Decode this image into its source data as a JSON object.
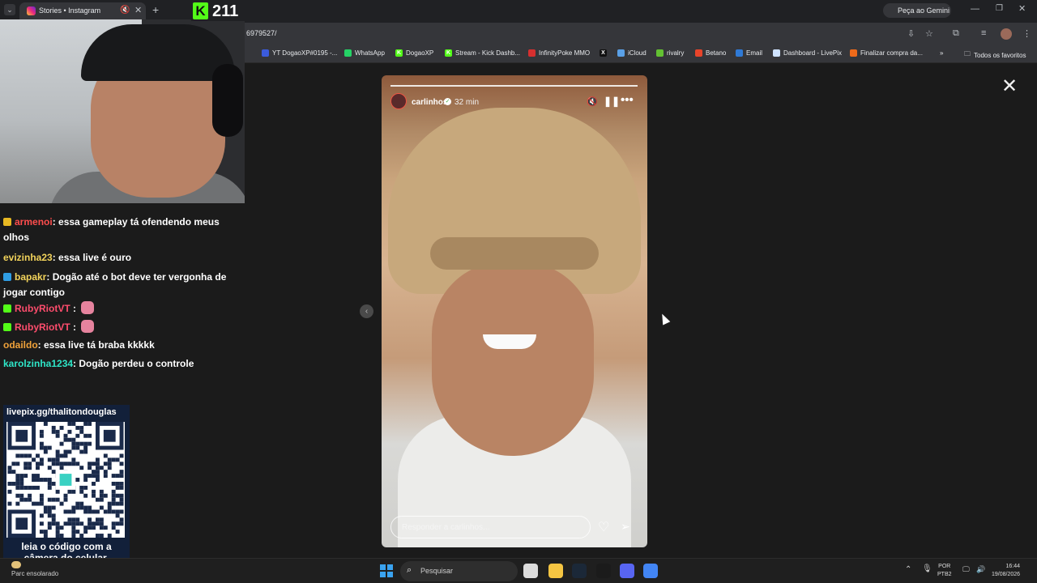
{
  "browser": {
    "tab_title": "Stories • Instagram",
    "new_tab": "+",
    "url_fragment": "6979527/",
    "gemini_label": "Peça ao Gemini",
    "bookmarks": [
      {
        "label": "YT DogaoXP#0195 -...",
        "color": "#3b5bdb",
        "glyph": ""
      },
      {
        "label": "WhatsApp",
        "color": "#25d366",
        "glyph": ""
      },
      {
        "label": "DogaoXP",
        "color": "#53fc18",
        "glyph": "K"
      },
      {
        "label": "Stream - Kick Dashb...",
        "color": "#53fc18",
        "glyph": "K"
      },
      {
        "label": "InfinityPoke MMO",
        "color": "#d62f2f",
        "glyph": ""
      },
      {
        "label": "",
        "color": "#111111",
        "glyph": "X"
      },
      {
        "label": "iCloud",
        "color": "#5aa0e6",
        "glyph": ""
      },
      {
        "label": "rivalry",
        "color": "#63c132",
        "glyph": ""
      },
      {
        "label": "Betano",
        "color": "#e8442a",
        "glyph": ""
      },
      {
        "label": "Email",
        "color": "#2f7ad6",
        "glyph": ""
      },
      {
        "label": "Dashboard - LivePix",
        "color": "#cfe3ff",
        "glyph": ""
      },
      {
        "label": "Finalizar compra da...",
        "color": "#ee6a1a",
        "glyph": ""
      }
    ],
    "bookmarks_overflow": "»",
    "all_favorites": "Todos os favoritos"
  },
  "stream": {
    "viewer_count": "211",
    "kick_glyph": "K"
  },
  "chat": [
    {
      "user": "armenoi",
      "user_color": "#ff4d4d",
      "badge_color": "#e8b923",
      "text": ": essa gameplay tá ofendendo meus olhos",
      "emote": false
    },
    {
      "user": "evizinha23",
      "user_color": "#f2d35b",
      "badge_color": "",
      "text": ": essa live é ouro",
      "emote": false
    },
    {
      "user": "bapakr",
      "user_color": "#f2d35b",
      "badge_color": "#2f9de4",
      "text": ": Dogão até o bot deve ter vergonha de jogar contigo",
      "emote": false
    },
    {
      "user": "RubyRiotVT",
      "user_color": "#ff4d6d",
      "badge_color": "#53fc18",
      "text": " :",
      "emote": true
    },
    {
      "user": "RubyRiotVT",
      "user_color": "#ff4d6d",
      "badge_color": "#53fc18",
      "text": " :",
      "emote": true
    },
    {
      "user": "odaildo",
      "user_color": "#f0a23a",
      "badge_color": "",
      "text": ": essa live tá braba kkkkk",
      "emote": false
    },
    {
      "user": "karolzinha1234",
      "user_color": "#2ee6c8",
      "badge_color": "",
      "text": ": Dogão perdeu o controle",
      "emote": false
    }
  ],
  "qr": {
    "url": "livepix.gg/thalitondouglas",
    "caption_1": "leia o código com a",
    "caption_2": "câmera do celular."
  },
  "story": {
    "username": "carlinhos",
    "verified_glyph": "✓",
    "time": "32 min",
    "reply_placeholder": "Responder a carlinhos...",
    "progress": 1.0
  },
  "viewer": {
    "close_glyph": "✕",
    "prev_glyph": "‹"
  },
  "taskbar": {
    "weather": "Parc ensolarado",
    "search_placeholder": "Pesquisar",
    "lang_1": "POR",
    "lang_2": "PTB2",
    "time": "16:44",
    "date": "19/08/2026",
    "apps": [
      {
        "name": "task-view",
        "color": "#dcdcdc"
      },
      {
        "name": "file-explorer",
        "color": "#f5c542"
      },
      {
        "name": "steam",
        "color": "#1b2838"
      },
      {
        "name": "kick",
        "color": "#1b1b1b"
      },
      {
        "name": "discord",
        "color": "#5865f2"
      },
      {
        "name": "chrome",
        "color": "#4285f4"
      }
    ]
  }
}
